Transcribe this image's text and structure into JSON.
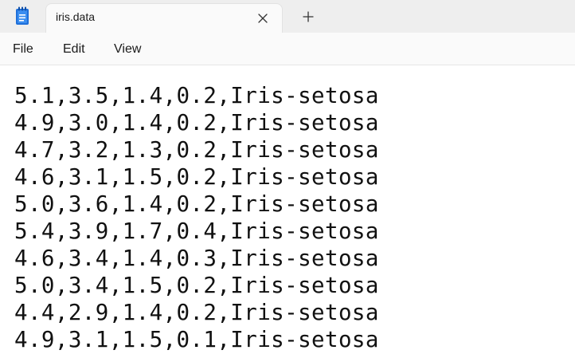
{
  "tab": {
    "title": "iris.data",
    "close_icon": "close-icon",
    "new_tab_icon": "plus-icon"
  },
  "app_icon": "notepad-icon",
  "menu": {
    "file": "File",
    "edit": "Edit",
    "view": "View"
  },
  "editor": {
    "lines": [
      "5.1,3.5,1.4,0.2,Iris-setosa",
      "4.9,3.0,1.4,0.2,Iris-setosa",
      "4.7,3.2,1.3,0.2,Iris-setosa",
      "4.6,3.1,1.5,0.2,Iris-setosa",
      "5.0,3.6,1.4,0.2,Iris-setosa",
      "5.4,3.9,1.7,0.4,Iris-setosa",
      "4.6,3.4,1.4,0.3,Iris-setosa",
      "5.0,3.4,1.5,0.2,Iris-setosa",
      "4.4,2.9,1.4,0.2,Iris-setosa",
      "4.9,3.1,1.5,0.1,Iris-setosa"
    ]
  },
  "colors": {
    "tabbar_bg": "#eeeeee",
    "menubar_bg": "#fafafa",
    "text": "#111111",
    "icon_blue": "#1e6fd9"
  }
}
